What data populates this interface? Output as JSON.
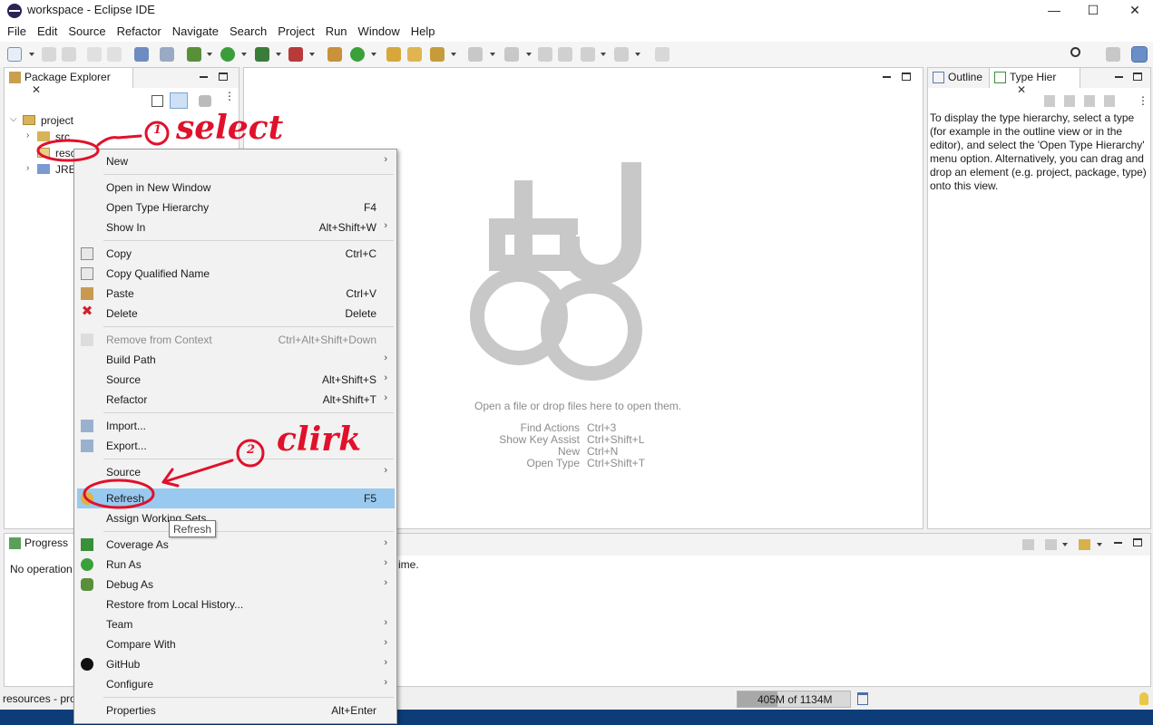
{
  "window": {
    "title": "workspace - Eclipse IDE",
    "controls": {
      "minimize": "—",
      "maximize": "☐",
      "close": "✕"
    }
  },
  "menubar": [
    "File",
    "Edit",
    "Source",
    "Refactor",
    "Navigate",
    "Search",
    "Project",
    "Run",
    "Window",
    "Help"
  ],
  "package_explorer": {
    "tab_label": "Package Explorer",
    "tree": [
      {
        "label": "project",
        "expanded": true
      },
      {
        "label": "src"
      },
      {
        "label": "resc"
      },
      {
        "label": "JRE"
      }
    ]
  },
  "editor": {
    "drop_hint": "Open a file or drop files here to open them.",
    "shortcuts": [
      {
        "action": "Find Actions",
        "keys": "Ctrl+3"
      },
      {
        "action": "Show Key Assist",
        "keys": "Ctrl+Shift+L"
      },
      {
        "action": "New",
        "keys": "Ctrl+N"
      },
      {
        "action": "Open Type",
        "keys": "Ctrl+Shift+T"
      }
    ]
  },
  "right_panel": {
    "tabs": [
      "Outline",
      "Type Hier"
    ],
    "message": "To display the type hierarchy, select a type (for example in the outline view or in the editor), and select the 'Open Type Hierarchy' menu option. Alternatively, you can drag and drop an element (e.g. project, package, type) onto this view."
  },
  "bottom_panel": {
    "tab_label": "Progress",
    "message_start": "No operation",
    "message_end": "ime."
  },
  "context_menu": {
    "items": [
      {
        "label": "New",
        "accel": "",
        "submenu": true
      },
      {
        "label": "Open in New Window",
        "accel": ""
      },
      {
        "label": "Open Type Hierarchy",
        "accel": "F4"
      },
      {
        "label": "Show In",
        "accel": "Alt+Shift+W",
        "submenu": true
      },
      {
        "label": "Copy",
        "accel": "Ctrl+C",
        "icon": "copy-icon"
      },
      {
        "label": "Copy Qualified Name",
        "accel": "",
        "icon": "copy-qualified-icon"
      },
      {
        "label": "Paste",
        "accel": "Ctrl+V",
        "icon": "paste-icon"
      },
      {
        "label": "Delete",
        "accel": "Delete",
        "icon": "delete-icon"
      },
      {
        "label": "Remove from Context",
        "accel": "Ctrl+Alt+Shift+Down",
        "disabled": true,
        "icon": "remove-context-icon"
      },
      {
        "label": "Build Path",
        "accel": "",
        "submenu": true
      },
      {
        "label": "Source",
        "accel": "Alt+Shift+S",
        "submenu": true
      },
      {
        "label": "Refactor",
        "accel": "Alt+Shift+T",
        "submenu": true
      },
      {
        "label": "Import...",
        "accel": "",
        "icon": "import-icon"
      },
      {
        "label": "Export...",
        "accel": "",
        "icon": "export-icon"
      },
      {
        "label": "Source",
        "accel": "",
        "submenu": true
      },
      {
        "label": "Refresh",
        "accel": "F5",
        "selected": true,
        "icon": "refresh-icon"
      },
      {
        "label": "Assign Working Sets...",
        "accel": ""
      },
      {
        "label": "Coverage As",
        "accel": "",
        "submenu": true,
        "icon": "coverage-icon"
      },
      {
        "label": "Run As",
        "accel": "",
        "submenu": true,
        "icon": "run-icon"
      },
      {
        "label": "Debug As",
        "accel": "",
        "submenu": true,
        "icon": "debug-icon"
      },
      {
        "label": "Restore from Local History...",
        "accel": ""
      },
      {
        "label": "Team",
        "accel": "",
        "submenu": true
      },
      {
        "label": "Compare With",
        "accel": "",
        "submenu": true
      },
      {
        "label": "GitHub",
        "accel": "",
        "submenu": true,
        "icon": "github-icon"
      },
      {
        "label": "Configure",
        "accel": "",
        "submenu": true
      },
      {
        "label": "Properties",
        "accel": "Alt+Enter"
      }
    ]
  },
  "tooltip": "Refresh",
  "statusbar": {
    "left": "resources - pro",
    "heap": "405M of 1134M"
  },
  "annotations": {
    "step1": "select",
    "step2": "clirk",
    "step1_number": "1",
    "step2_number": "2"
  }
}
